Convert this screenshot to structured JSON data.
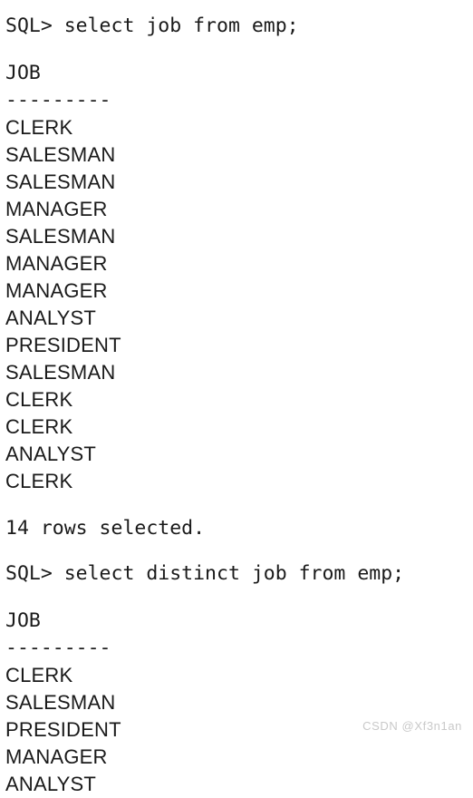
{
  "terminal": {
    "prompt_symbol": "SQL>",
    "text_color": "#1a1a1a",
    "background_color": "#ffffff",
    "blocks": [
      {
        "command": "SQL> select job from emp;",
        "header": "JOB",
        "rule": "---------",
        "rows": [
          "CLERK",
          "SALESMAN",
          "SALESMAN",
          "MANAGER",
          "SALESMAN",
          "MANAGER",
          "MANAGER",
          "ANALYST",
          "PRESIDENT",
          "SALESMAN",
          "CLERK",
          "CLERK",
          "ANALYST",
          "CLERK"
        ],
        "status": "14 rows selected."
      },
      {
        "command": "SQL> select distinct job from emp;",
        "header": "JOB",
        "rule": "---------",
        "rows": [
          "CLERK",
          "SALESMAN",
          "PRESIDENT",
          "MANAGER",
          "ANALYST"
        ],
        "status": ""
      }
    ]
  },
  "watermark": {
    "text": "CSDN @Xf3n1an",
    "color": "#c9c9c9"
  }
}
